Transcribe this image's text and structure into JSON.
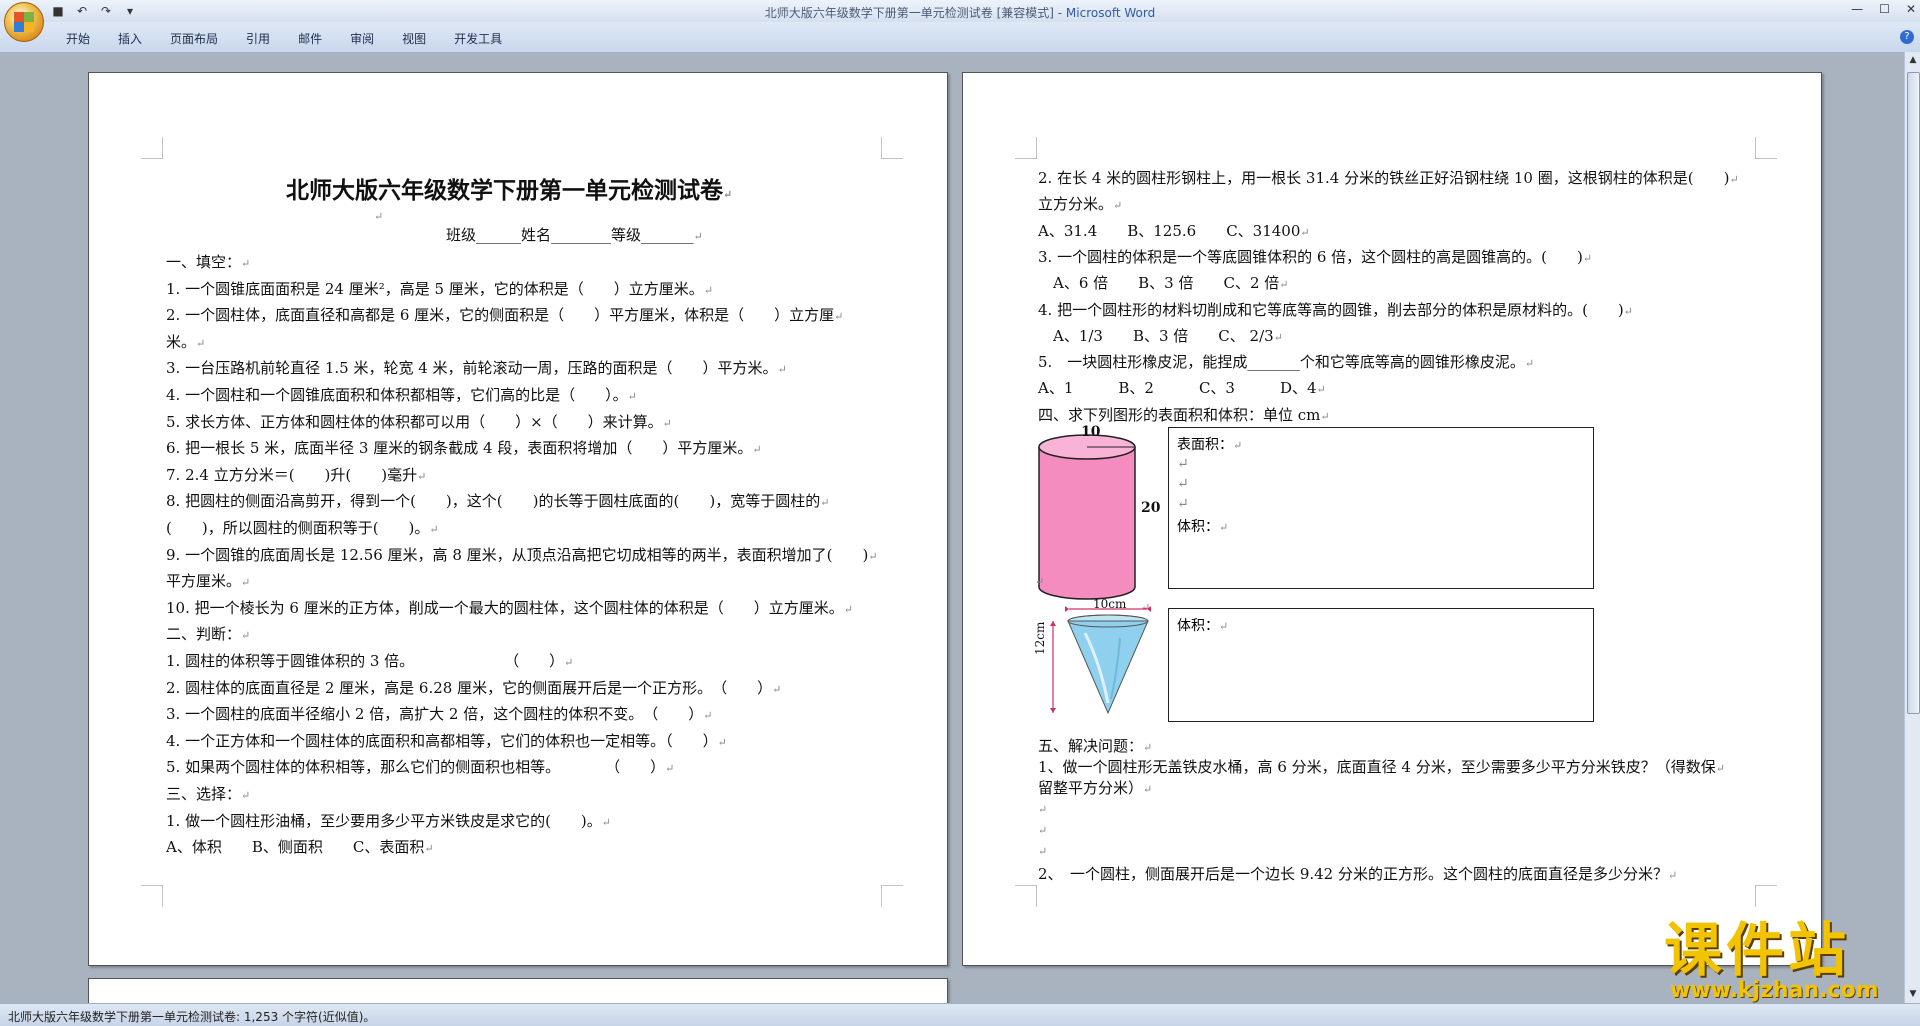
{
  "window": {
    "title": "北师大版六年级数学下册第一单元检测试卷 [兼容模式] - ",
    "app_name": "Microsoft Word"
  },
  "ribbon": {
    "tabs": [
      "开始",
      "插入",
      "页面布局",
      "引用",
      "邮件",
      "审阅",
      "视图",
      "开发工具"
    ]
  },
  "status_bar": {
    "text": "北师大版六年级数学下册第一单元检测试卷: 1,253 个字符(近似值)。"
  },
  "page1": {
    "title": "北师大版六年级数学下册第一单元检测试卷",
    "info_line": "班级______姓名________等级_______",
    "lines": [
      "一、填空：",
      "1. 一个圆锥底面面积是 24 厘米²，高是 5 厘米，它的体积是（　　）立方厘米。",
      "2. 一个圆柱体，底面直径和高都是 6 厘米，它的侧面积是（　　）平方厘米，体积是（　　）立方厘",
      "米。",
      "3. 一台压路机前轮直径 1.5 米，轮宽 4 米，前轮滚动一周，压路的面积是（　　）平方米。",
      "4. 一个圆柱和一个圆锥底面积和体积都相等，它们高的比是（　　）。",
      "5. 求长方体、正方体和圆柱体的体积都可以用（　　）×（　　）来计算。",
      "6. 把一根长 5 米，底面半径 3 厘米的钢条截成 4 段，表面积将增加（　　）平方厘米。",
      "7. 2.4 立方分米＝(　　)升(　　)毫升",
      "8. 把圆柱的侧面沿高剪开，得到一个(　　)，这个(　　)的长等于圆柱底面的(　　)，宽等于圆柱的",
      "(　　)，所以圆柱的侧面积等于(　　)。",
      "9. 一个圆锥的底面周长是 12.56 厘米，高 8 厘米，从顶点沿高把它切成相等的两半，表面积增加了(　　)",
      "平方厘米。",
      "10. 把一个棱长为 6 厘米的正方体，削成一个最大的圆柱体，这个圆柱体的体积是（　　）立方厘米。",
      "二、判断：",
      "1. 圆柱的体积等于圆锥体积的 3 倍。　　　　　　　（　　）",
      "2. 圆柱体的底面直径是 2 厘米，高是 6.28 厘米，它的侧面展开后是一个正方形。　（　　）",
      "3. 一个圆柱的底面半径缩小 2 倍，高扩大 2 倍，这个圆柱的体积不变。　（　　）",
      "4. 一个正方体和一个圆柱体的底面积和高都相等，它们的体积也一定相等。（　　）",
      "5. 如果两个圆柱体的体积相等，那么它们的侧面积也相等。　　　　（　　）",
      "三、选择：",
      "1. 做一个圆柱形油桶，至少要用多少平方米铁皮是求它的(　　)。",
      "A、体积　　B、侧面积　　C、表面积"
    ]
  },
  "page2": {
    "lines_top": [
      "2. 在长 4 米的圆柱形钢柱上，用一根长 31.4 分米的铁丝正好沿钢柱绕 10 圈，这根钢柱的体积是(　　)",
      "立方分米。",
      "A、31.4　　B、125.6　　C、31400",
      "3. 一个圆柱的体积是一个等底圆锥体积的 6 倍，这个圆柱的高是圆锥高的。(　　)",
      "　A、6 倍　　B、3 倍　　C、2 倍",
      "4. 把一个圆柱形的材料切削成和它等底等高的圆锥，削去部分的体积是原材料的。(　　)",
      "　A、1/3　　B、3 倍　　C、 2/3",
      "5.　一块圆柱形橡皮泥，能捏成_______个和它等底等高的圆锥形橡皮泥。",
      "A、1　　　B、2　　　C、3　　　D、4",
      "四、求下列图形的表面积和体积：单位 cm"
    ],
    "cylinder": {
      "top_label": "10",
      "side_label": "20"
    },
    "box1": {
      "label1": "表面积：",
      "label2": "体积："
    },
    "cone": {
      "top_label": "10cm",
      "side_label": "12cm"
    },
    "box2": {
      "label1": "体积："
    },
    "lines_bottom": [
      "五、解决问题：",
      "1、做一个圆柱形无盖铁皮水桶，高 6 分米，底面直径 4 分米，至少需要多少平方分米铁皮？（得数保",
      "留整平方分米）",
      "2、　一个圆柱，侧面展开后是一个边长 9.42 分米的正方形。这个圆柱的底面直径是多少分米？"
    ]
  },
  "watermark": {
    "main": "课件站",
    "url": "www.kjzhan.com"
  }
}
